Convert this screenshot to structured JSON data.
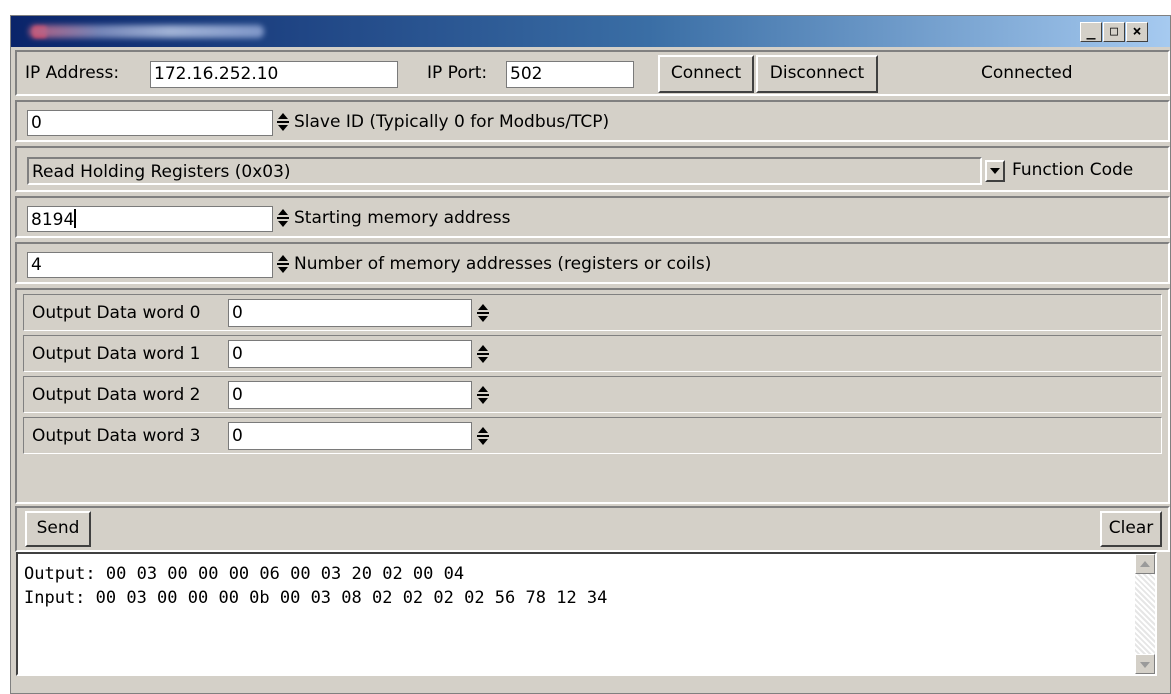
{
  "window": {
    "title": "Modbus TCP Client",
    "controls": {
      "minimize": "_",
      "maximize": "□",
      "close": "×"
    }
  },
  "connection": {
    "ip_label": "IP Address:",
    "ip_value": "172.16.252.10",
    "port_label": "IP Port:",
    "port_value": "502",
    "connect_label": "Connect",
    "disconnect_label": "Disconnect",
    "status": "Connected"
  },
  "slave": {
    "value": "0",
    "label": "Slave ID (Typically 0 for Modbus/TCP)"
  },
  "function": {
    "selected": "Read Holding Registers (0x03)",
    "label": "Function Code"
  },
  "start_address": {
    "value": "8194",
    "label": "Starting memory address"
  },
  "count": {
    "value": "4",
    "label": "Number of memory addresses (registers or coils)"
  },
  "output_words": [
    {
      "label": "Output Data word 0",
      "value": "0"
    },
    {
      "label": "Output Data word 1",
      "value": "0"
    },
    {
      "label": "Output Data word 2",
      "value": "0"
    },
    {
      "label": "Output Data word 3",
      "value": "0"
    }
  ],
  "actions": {
    "send_label": "Send",
    "clear_label": "Clear"
  },
  "console": {
    "lines": [
      "Output: 00 03 00 00 00 06 00 03 20 02 00 04",
      "Input: 00 03 00 00 00 0b 00 03 08 02 02 02 02 56 78 12 34"
    ]
  }
}
